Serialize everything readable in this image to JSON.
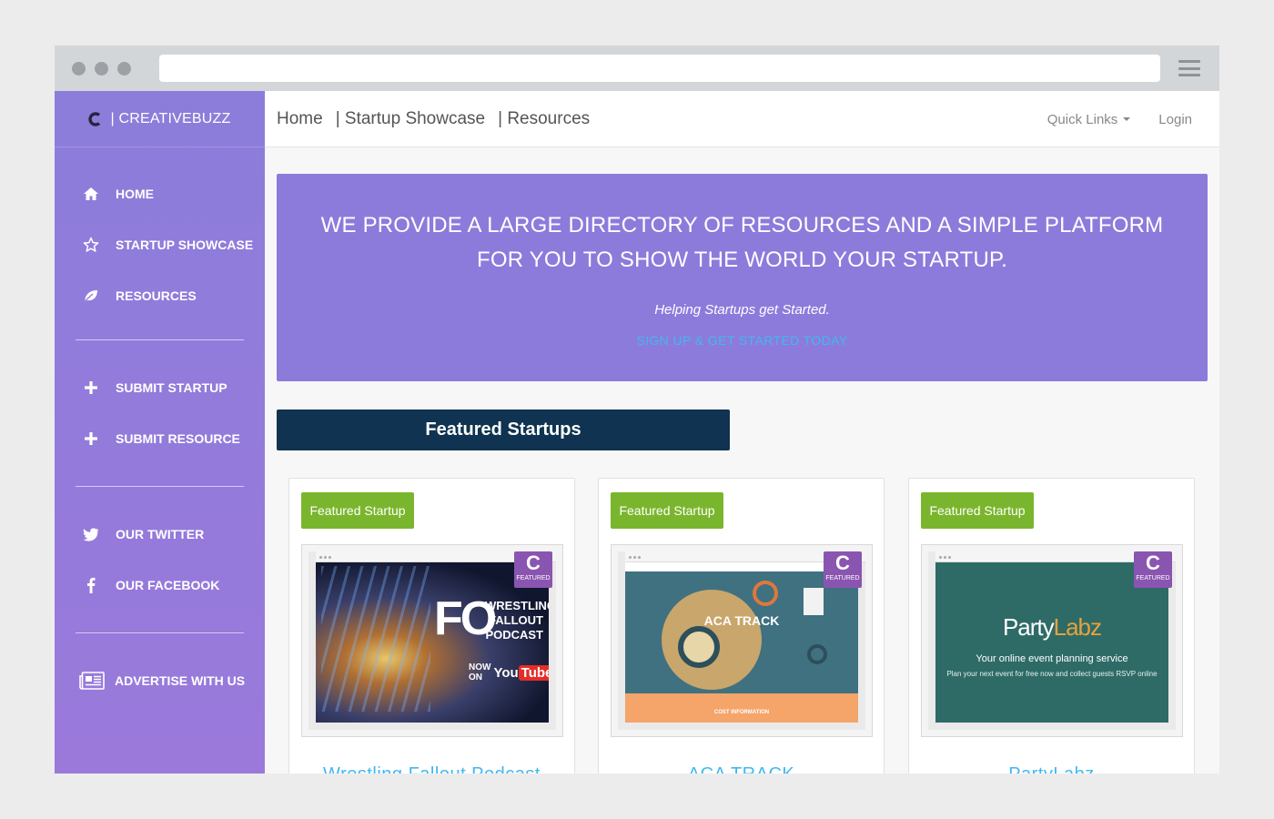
{
  "brand": {
    "name": "| CREATIVEBUZZ"
  },
  "sidebar": {
    "primary": [
      {
        "label": "HOME",
        "icon": "home-icon"
      },
      {
        "label": "STARTUP SHOWCASE",
        "icon": "star-icon"
      },
      {
        "label": "RESOURCES",
        "icon": "leaf-icon"
      }
    ],
    "submit": [
      {
        "label": "SUBMIT STARTUP",
        "icon": "plus-icon"
      },
      {
        "label": "SUBMIT RESOURCE",
        "icon": "plus-icon"
      }
    ],
    "social": [
      {
        "label": "OUR TWITTER",
        "icon": "twitter-icon"
      },
      {
        "label": "OUR FACEBOOK",
        "icon": "facebook-icon"
      }
    ],
    "advertise": {
      "label": "ADVERTISE WITH US",
      "icon": "newspaper-icon"
    }
  },
  "topnav": {
    "links": [
      "Home",
      "| Startup Showcase",
      "| Resources"
    ],
    "quick_links": "Quick Links",
    "login": "Login"
  },
  "hero": {
    "title": "WE PROVIDE A LARGE DIRECTORY OF RESOURCES AND A SIMPLE PLATFORM FOR YOU TO SHOW THE WORLD YOUR STARTUP.",
    "subtitle": "Helping Startups get Started.",
    "cta": "SIGN UP & GET STARTED TODAY"
  },
  "featured": {
    "heading": "Featured Startups",
    "cards": [
      {
        "badge": "Featured Startup",
        "ribbon_letter": "C",
        "ribbon_text": "FEATURED",
        "title": "Wrestling Fallout Podcast",
        "shot": {
          "big": "FO",
          "lines": [
            "WRESTLING",
            "FALLOUT",
            "PODCAST"
          ],
          "now_on": "NOW ON",
          "yt": "You",
          "tube": "Tube"
        }
      },
      {
        "badge": "Featured Startup",
        "ribbon_letter": "C",
        "ribbon_text": "FEATURED",
        "title": "ACA TRACK",
        "shot": {
          "heading": "ACA TRACK",
          "footer": "COST INFORMATION"
        }
      },
      {
        "badge": "Featured Startup",
        "ribbon_letter": "C",
        "ribbon_text": "FEATURED",
        "title": "PartyLabz",
        "shot": {
          "logo_a": "Party",
          "logo_b": "Labz",
          "tagline": "Your online event planning service",
          "small": "Plan your next event for free now and collect guests RSVP online"
        }
      }
    ]
  },
  "colors": {
    "sidebar": "#8c7ddb",
    "hero": "#8c7bdb",
    "featured_bar": "#0f3350",
    "badge": "#7ab62d",
    "link": "#41b8f0"
  }
}
